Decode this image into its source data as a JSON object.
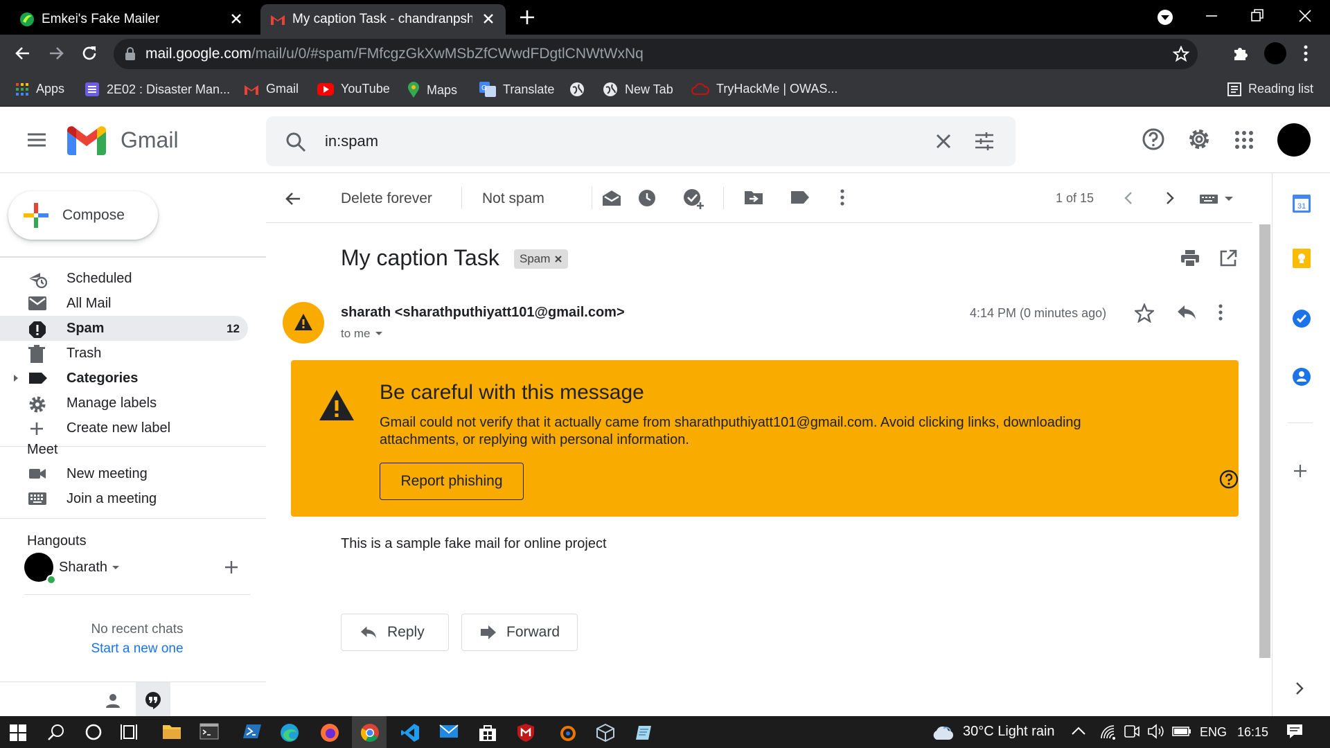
{
  "browser": {
    "tabs": [
      {
        "title": "Emkei's Fake Mailer"
      },
      {
        "title": "My caption Task - chandranpsharathputhiyatt"
      }
    ],
    "url_host": "mail.google.com",
    "url_path": "/mail/u/0/#spam/FMfcgzGkXwMSbZfCWwdFDgtlCNWtWxNq",
    "bookmarks": [
      {
        "label": "Apps"
      },
      {
        "label": "2E02 : Disaster Man..."
      },
      {
        "label": "Gmail"
      },
      {
        "label": "YouTube"
      },
      {
        "label": "Maps"
      },
      {
        "label": "Translate"
      },
      {
        "label": ""
      },
      {
        "label": "New Tab"
      },
      {
        "label": "TryHackMe | OWAS..."
      }
    ],
    "reading_list": "Reading list"
  },
  "gmail": {
    "brand": "Gmail",
    "search_value": "in:spam"
  },
  "sidebar": {
    "compose_label": "Compose",
    "items": [
      {
        "label": "Scheduled"
      },
      {
        "label": "All Mail"
      },
      {
        "label": "Spam",
        "count": "12"
      },
      {
        "label": "Trash"
      },
      {
        "label": "Categories"
      },
      {
        "label": "Manage labels"
      },
      {
        "label": "Create new label"
      }
    ],
    "meet_title": "Meet",
    "meet_items": [
      {
        "label": "New meeting"
      },
      {
        "label": "Join a meeting"
      }
    ],
    "hangouts_title": "Hangouts",
    "hangouts_user": "Sharath",
    "no_recent": "No recent chats",
    "start_new": "Start a new one"
  },
  "actions": {
    "delete_forever": "Delete forever",
    "not_spam": "Not spam",
    "pager": "1 of 15"
  },
  "message": {
    "subject": "My caption Task",
    "label_chip": "Spam",
    "sender": "sharath <sharathputhiyatt101@gmail.com>",
    "to": "to me",
    "time": "4:14 PM (0 minutes ago)",
    "warning_title": "Be careful with this message",
    "warning_body": "Gmail could not verify that it actually came from sharathputhiyatt101@gmail.com. Avoid clicking links, downloading attachments, or replying with personal information.",
    "report_label": "Report phishing",
    "body": "This is a sample fake mail for online project",
    "reply_label": "Reply",
    "forward_label": "Forward"
  },
  "taskbar": {
    "weather": "30°C  Light rain",
    "lang": "ENG",
    "clock": "16:15"
  },
  "colors": {
    "warning_bg": "#f9ab00",
    "active_nav_bg": "#e8eaed",
    "link_blue": "#1a73e8",
    "browser_dark": "#35363a"
  }
}
